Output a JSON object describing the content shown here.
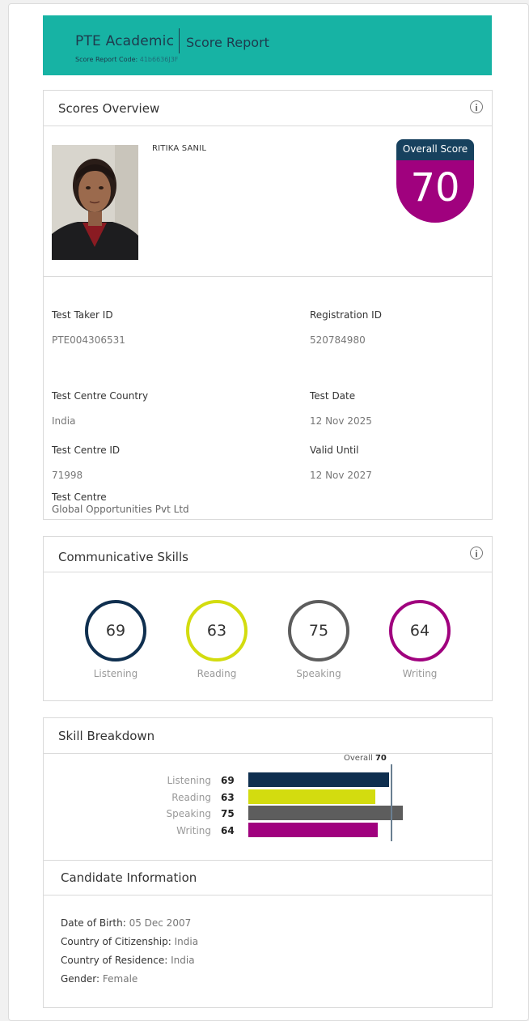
{
  "header": {
    "brand": "PTE Academic",
    "report_title": "Score Report",
    "code_label": "Score Report Code:",
    "code_value": "41b6636J3F"
  },
  "scores_overview": {
    "title": "Scores Overview",
    "candidate_name": "RITIKA SANIL",
    "overall_label": "Overall Score",
    "overall_value": "70",
    "fields": {
      "test_taker_id": {
        "label": "Test Taker ID",
        "value": "PTE004306531"
      },
      "registration_id": {
        "label": "Registration ID",
        "value": "520784980"
      },
      "test_centre_country": {
        "label": "Test Centre Country",
        "value": "India"
      },
      "test_date": {
        "label": "Test Date",
        "value": "12 Nov 2025"
      },
      "test_centre_id": {
        "label": "Test Centre ID",
        "value": "71998"
      },
      "valid_until": {
        "label": "Valid Until",
        "value": "12 Nov 2027"
      },
      "test_centre": {
        "label": "Test Centre",
        "value": "Global Opportunities Pvt Ltd"
      }
    }
  },
  "communicative_skills": {
    "title": "Communicative Skills",
    "skills": [
      {
        "label": "Listening",
        "score": "69",
        "color": "#0f2f4f"
      },
      {
        "label": "Reading",
        "score": "63",
        "color": "#d3dc0f"
      },
      {
        "label": "Speaking",
        "score": "75",
        "color": "#5d5d5d"
      },
      {
        "label": "Writing",
        "score": "64",
        "color": "#a0017e"
      }
    ]
  },
  "skill_breakdown": {
    "title": "Skill Breakdown",
    "overall_label": "Overall",
    "overall_value": "70",
    "scale_min": 10,
    "scale_max": 90,
    "overall": 70,
    "rows": [
      {
        "label": "Listening",
        "score": "69",
        "value": 69,
        "color": "#0f2f4f"
      },
      {
        "label": "Reading",
        "score": "63",
        "value": 63,
        "color": "#d3dc0f"
      },
      {
        "label": "Speaking",
        "score": "75",
        "value": 75,
        "color": "#5d5d5d"
      },
      {
        "label": "Writing",
        "score": "64",
        "value": 64,
        "color": "#a0017e"
      }
    ]
  },
  "candidate_information": {
    "title": "Candidate Information",
    "items": [
      {
        "label": "Date of Birth:",
        "value": "05 Dec 2007"
      },
      {
        "label": "Country of Citizenship:",
        "value": "India"
      },
      {
        "label": "Country of Residence:",
        "value": "India"
      },
      {
        "label": "Gender:",
        "value": "Female"
      }
    ]
  },
  "colors": {
    "brand_teal": "#17b3a4",
    "navy": "#17415e",
    "magenta": "#a0017e"
  }
}
